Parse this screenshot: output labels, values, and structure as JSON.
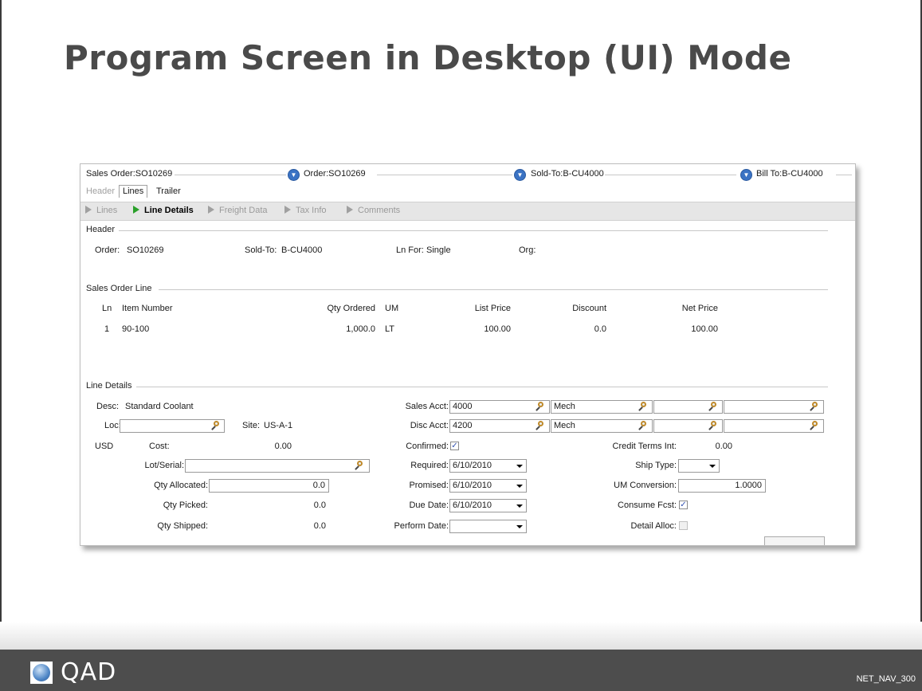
{
  "slide": {
    "title": "Program Screen in Desktop (UI) Mode",
    "footer_code": "NET_NAV_300",
    "logo_text": "QAD"
  },
  "window": {
    "top_fields": [
      {
        "label": "Sales Order:SO10269"
      },
      {
        "label": "Order:SO10269"
      },
      {
        "label": "Sold-To:B-CU4000"
      },
      {
        "label": "Bill To:B-CU4000"
      }
    ],
    "tabs": [
      "Header",
      "Lines",
      "Trailer"
    ],
    "active_tab": "Lines",
    "nav": [
      "Lines",
      "Line Details",
      "Freight Data",
      "Tax Info",
      "Comments"
    ],
    "active_nav": "Line Details",
    "header_section": {
      "title": "Header",
      "order_label": "Order:",
      "order_value": "SO10269",
      "sold_to_label": "Sold-To:",
      "sold_to_value": "B-CU4000",
      "ln_for_label": "Ln For:",
      "ln_for_value": "Single",
      "org_label": "Org:"
    },
    "sales_order_line": {
      "title": "Sales Order Line",
      "columns": [
        "Ln",
        "Item Number",
        "Qty Ordered",
        "UM",
        "List Price",
        "Discount",
        "Net Price"
      ],
      "rows": [
        {
          "ln": "1",
          "item": "90-100",
          "qty": "1,000.0",
          "um": "LT",
          "list_price": "100.00",
          "discount": "0.0",
          "net_price": "100.00"
        }
      ]
    },
    "line_details": {
      "title": "Line Details",
      "desc_label": "Desc:",
      "desc_value": "Standard Coolant",
      "loc_label": "Loc:",
      "loc_value": "",
      "site_label": "Site:",
      "site_value": "US-A-1",
      "currency": "USD",
      "cost_label": "Cost:",
      "cost_value": "0.00",
      "lot_serial_label": "Lot/Serial:",
      "lot_serial_value": "",
      "qty_allocated_label": "Qty Allocated:",
      "qty_allocated_value": "0.0",
      "qty_picked_label": "Qty Picked:",
      "qty_picked_value": "0.0",
      "qty_shipped_label": "Qty Shipped:",
      "qty_shipped_value": "0.0",
      "sales_acct_label": "Sales Acct:",
      "sales_acct_value": "4000",
      "sales_sub_value": "Mech",
      "disc_acct_label": "Disc Acct:",
      "disc_acct_value": "4200",
      "disc_sub_value": "Mech",
      "confirmed_label": "Confirmed:",
      "confirmed_checked": "✓",
      "required_label": "Required:",
      "required_value": "6/10/2010",
      "promised_label": "Promised:",
      "promised_value": "6/10/2010",
      "due_date_label": "Due Date:",
      "due_date_value": "6/10/2010",
      "perform_date_label": "Perform Date:",
      "perform_date_value": "",
      "credit_terms_label": "Credit Terms Int:",
      "credit_terms_value": "0.00",
      "ship_type_label": "Ship Type:",
      "ship_type_value": "",
      "um_conversion_label": "UM Conversion:",
      "um_conversion_value": "1.0000",
      "consume_fcst_label": "Consume Fcst:",
      "consume_fcst_checked": "✓",
      "detail_alloc_label": "Detail Alloc:"
    }
  }
}
